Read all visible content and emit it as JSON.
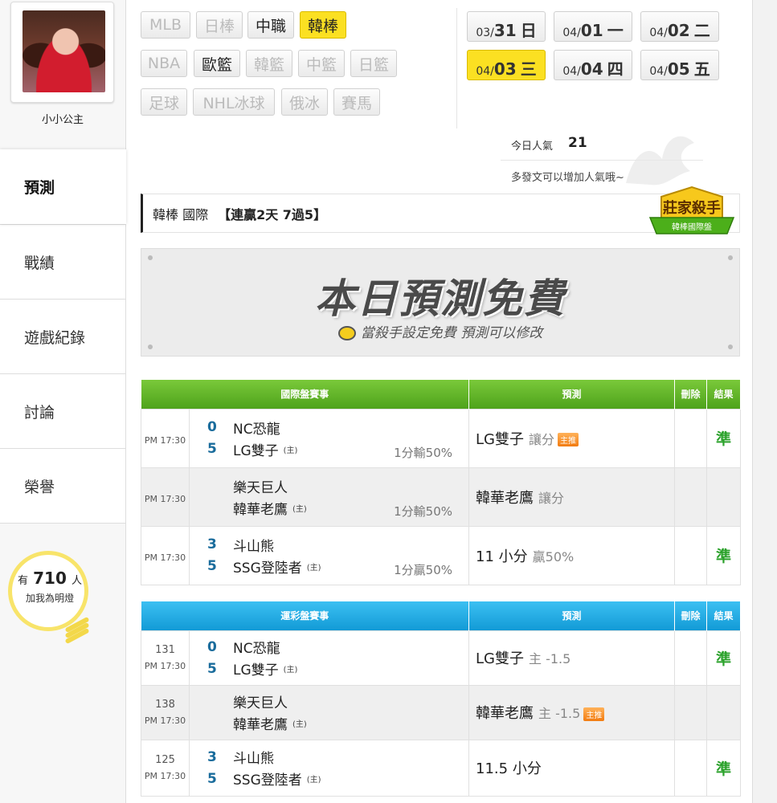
{
  "sidebar": {
    "user_name": "小小公主",
    "nav": [
      "預測",
      "戰績",
      "遊戲紀錄",
      "討論",
      "榮譽"
    ],
    "fans": {
      "prefix": "有",
      "count": "710",
      "suffix": "人",
      "cta": "加我為明燈"
    }
  },
  "leagues": [
    {
      "label": "MLB",
      "state": "disabled"
    },
    {
      "label": "日棒",
      "state": "disabled"
    },
    {
      "label": "中職",
      "state": "normal"
    },
    {
      "label": "韓棒",
      "state": "active"
    },
    {
      "label": "NBA",
      "state": "disabled"
    },
    {
      "label": "歐籃",
      "state": "normal"
    },
    {
      "label": "韓籃",
      "state": "disabled"
    },
    {
      "label": "中籃",
      "state": "disabled"
    },
    {
      "label": "日籃",
      "state": "disabled"
    },
    {
      "label": "足球",
      "state": "disabled"
    },
    {
      "label": "NHL冰球",
      "state": "disabled"
    },
    {
      "label": "俄冰",
      "state": "disabled"
    },
    {
      "label": "賽馬",
      "state": "disabled"
    }
  ],
  "dates": [
    {
      "md1": "03/",
      "md2": "31",
      "wd": "日",
      "active": false
    },
    {
      "md1": "04/",
      "md2": "01",
      "wd": "一",
      "active": false
    },
    {
      "md1": "04/",
      "md2": "02",
      "wd": "二",
      "active": false
    },
    {
      "md1": "04/",
      "md2": "03",
      "wd": "三",
      "active": true
    },
    {
      "md1": "04/",
      "md2": "04",
      "wd": "四",
      "active": false
    },
    {
      "md1": "04/",
      "md2": "05",
      "wd": "五",
      "active": false
    }
  ],
  "popularity": {
    "label": "今日人氣",
    "value": "21",
    "hint": "多發文可以增加人氣哦~"
  },
  "title": {
    "league": "韓棒 國際",
    "streak": "【連贏2天 7過5】"
  },
  "badge": {
    "title": "莊家殺手",
    "sub": "韓棒國際盤"
  },
  "promo": {
    "title": "本日預測免費",
    "sub": "當殺手設定免費 預測可以修改"
  },
  "intl_table": {
    "headers": [
      "國際盤賽事",
      "預測",
      "刪除",
      "結果"
    ],
    "rows": [
      {
        "num": "",
        "time": "PM 17:30",
        "away": "NC恐龍",
        "away_score": "0",
        "home": "LG雙子",
        "home_score": "5",
        "host": "(主)",
        "spread": "1分輸50%",
        "pred": "LG雙子",
        "pred_sub": "讓分",
        "tag": "主推",
        "result": "準"
      },
      {
        "num": "",
        "time": "PM 17:30",
        "away": "樂天巨人",
        "away_score": "",
        "home": "韓華老鷹",
        "home_score": "",
        "host": "(主)",
        "spread": "1分輸50%",
        "pred": "韓華老鷹",
        "pred_sub": "讓分",
        "tag": "",
        "result": ""
      },
      {
        "num": "",
        "time": "PM 17:30",
        "away": "斗山熊",
        "away_score": "3",
        "home": "SSG登陸者",
        "home_score": "5",
        "host": "(主)",
        "spread": "1分贏50%",
        "pred": "11 小分",
        "pred_sub": "贏50%",
        "tag": "",
        "result": "準"
      }
    ]
  },
  "lottery_table": {
    "headers": [
      "運彩盤賽事",
      "預測",
      "刪除",
      "結果"
    ],
    "rows": [
      {
        "num": "131",
        "time": "PM 17:30",
        "away": "NC恐龍",
        "away_score": "0",
        "home": "LG雙子",
        "home_score": "5",
        "host": "(主)",
        "spread": "",
        "pred": "LG雙子",
        "pred_sub": "主 -1.5",
        "tag": "",
        "result": "準"
      },
      {
        "num": "138",
        "time": "PM 17:30",
        "away": "樂天巨人",
        "away_score": "",
        "home": "韓華老鷹",
        "home_score": "",
        "host": "(主)",
        "spread": "",
        "pred": "韓華老鷹",
        "pred_sub": "主 -1.5",
        "tag": "主推",
        "result": ""
      },
      {
        "num": "125",
        "time": "PM 17:30",
        "away": "斗山熊",
        "away_score": "3",
        "home": "SSG登陸者",
        "home_score": "5",
        "host": "(主)",
        "spread": "",
        "pred": "11.5 小分",
        "pred_sub": "",
        "tag": "",
        "result": "準"
      }
    ]
  },
  "colors": {
    "accent_yellow": "#fbe022",
    "intl_header": "#5fb22a",
    "lottery_header": "#22aee6",
    "win_green": "#2aa12a",
    "score_blue": "#1a6c9c"
  }
}
